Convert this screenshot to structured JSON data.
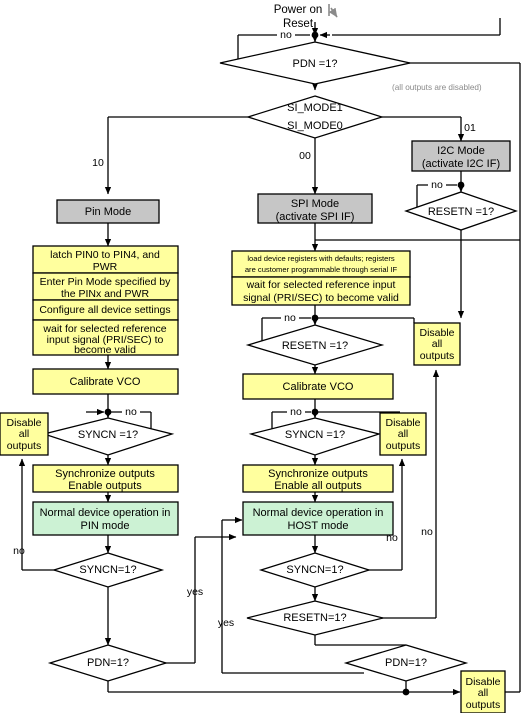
{
  "diagram": {
    "title": "Power on / Reset startup flowchart",
    "colors": {
      "process": "#ffff9e",
      "mode": "#c6c6c6",
      "normal_operation": "#ccf2d4",
      "decision": "#ffffff",
      "note_text": "#8a8a8a",
      "line": "#000000"
    },
    "start": {
      "line1": "Power on",
      "line2": "Reset"
    },
    "notes": {
      "all_outputs_disabled": "(all outputs are disabled)"
    },
    "decisions": {
      "pdn_top": "PDN =1?",
      "si_mode_line1": "SI_MODE1",
      "si_mode_line2": "SI_MODE0",
      "resetn_i2c": "RESETN =1?",
      "resetn_spi": "RESETN =1?",
      "syncn_pin_cal": "SYNCN =1?",
      "syncn_host_cal": "SYNCN =1?",
      "syncn_pin_run": "SYNCN=1?",
      "syncn_host_run": "SYNCN=1?",
      "resetn_host_run": "RESETN=1?",
      "pdn_pin_bottom": "PDN=1?",
      "pdn_host_bottom": "PDN=1?"
    },
    "modes": {
      "pin_mode": "Pin Mode",
      "spi_mode_line1": "SPI Mode",
      "spi_mode_line2": "(activate SPI IF)",
      "i2c_mode_line1": "I2C Mode",
      "i2c_mode_line2": "(activate I2C IF)"
    },
    "pin_steps": {
      "step1_line1": "latch PIN0 to PIN4, and",
      "step1_line2": "PWR",
      "step2_line1": "Enter Pin Mode specified by",
      "step2_line2": "the PINx and PWR",
      "step3": "Configure all device settings",
      "step4_line1": "wait for selected reference",
      "step4_line2": "input signal (PRI/SEC) to",
      "step4_line3": "become valid"
    },
    "spi_steps": {
      "step1_line1": "load device registers with defaults; registers",
      "step1_line2": "are customer programmable through serial IF",
      "step2_line1": "wait for selected reference input",
      "step2_line2": "signal (PRI/SEC) to become valid"
    },
    "calibrate_pin": "Calibrate VCO",
    "calibrate_host": "Calibrate VCO",
    "sync_pin": {
      "line1": "Synchronize outputs",
      "line2": "Enable outputs"
    },
    "sync_host": {
      "line1": "Synchronize outputs",
      "line2": "Enable all outputs"
    },
    "normal_pin": {
      "line1": "Normal device operation in",
      "line2": "PIN mode"
    },
    "normal_host": {
      "line1": "Normal device operation in",
      "line2": "HOST mode"
    },
    "disable_box": {
      "line1": "Disable",
      "line2": "all",
      "line3": "outputs"
    },
    "edge_labels": {
      "pdn_top_no": "no",
      "si_mode_10": "10",
      "si_mode_00": "00",
      "si_mode_01": "01",
      "resetn_i2c_no": "no",
      "resetn_spi_no": "no",
      "syncn_pin_cal_no": "no",
      "syncn_host_cal_no": "no",
      "syncn_pin_run_no": "no",
      "syncn_host_run_no": "no",
      "resetn_host_run_no": "no",
      "pdn_pin_yes": "yes",
      "pdn_host_yes": "yes"
    }
  }
}
